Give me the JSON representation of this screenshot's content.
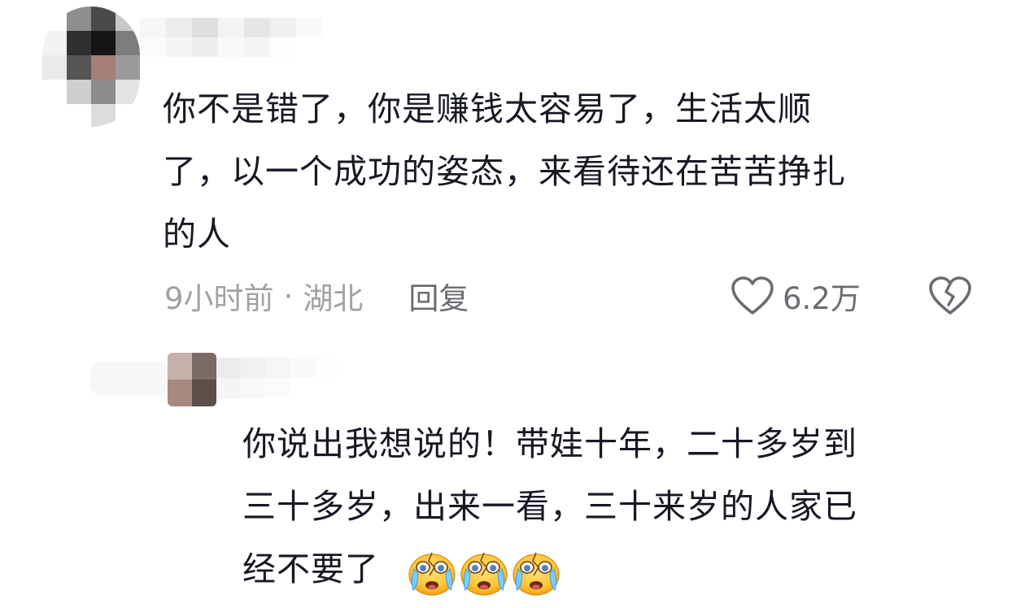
{
  "comment_1": {
    "text": "你不是错了，你是赚钱太容易了，生活太顺\n了，以一个成功的姿态，来看待还在苦苦挣扎\n的人",
    "time": "9小时前",
    "separator": "·",
    "location": "湖北",
    "reply_label": "回复",
    "like_count": "6.2万",
    "avatar_blocks": [
      "#ffffff",
      "#8e8e8e",
      "#4a4a4a",
      "#c9c9c9",
      "#f2f2f2",
      "#2f2f2f",
      "#151515",
      "#7d7d7d",
      "#eaeaea",
      "#555555",
      "#a57f78",
      "#9b9b9b",
      "#ffffff",
      "#cfcfcf",
      "#8c8c8c",
      "#e3e3e3",
      "#ffffff",
      "#ffffff",
      "#dcdcdc",
      "#ffffff"
    ],
    "name_blocks": [
      "#f6f6f6",
      "#ececec",
      "#dedede",
      "#f3f3f3",
      "#e6e6e6",
      "#f0f0f0",
      "#fafafa",
      "#fbfbfb",
      "#f5f5f5",
      "#eeeeee",
      "#f8f8f8",
      "#f4f4f4",
      "#fdfdfd",
      "#ffffff"
    ]
  },
  "comment_2": {
    "text": "你说出我想说的！带娃十年，二十多岁到\n三十多岁，出来一看，三十来岁的人家已\n经不要了",
    "emoji_count": 3,
    "emoji_name": "crying-face",
    "avatar_blocks": [
      "#c5b1aa",
      "#7b6a68",
      "#a8897f",
      "#5e4f4c"
    ],
    "name_blocks": [
      "#ececec",
      "#f1f1f1",
      "#f6f6f6",
      "#fafafa",
      "#fdfdfd",
      "#f5f5f5",
      "#f8f8f8",
      "#fbfbfb",
      "#ffffff",
      "#ffffff"
    ]
  },
  "colors": {
    "text_primary": "#161823",
    "text_meta": "#a0a1a6",
    "text_action": "#6b6c72"
  }
}
